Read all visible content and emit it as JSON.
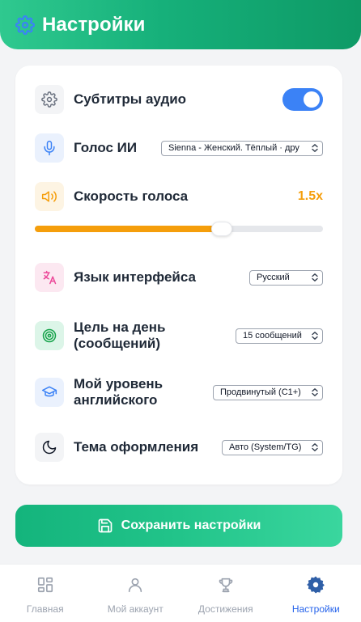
{
  "header": {
    "title": "Настройки",
    "icon": "gear-icon"
  },
  "settings": {
    "subtitles": {
      "label": "Субтитры аудио",
      "enabled": true,
      "icon": "gear-icon"
    },
    "voice": {
      "label": "Голос ИИ",
      "value": "Sienna - Женский. Тёплый · дру",
      "icon": "microphone-icon"
    },
    "speed": {
      "label": "Скорость голоса",
      "value": "1.5x",
      "level_percent": 65,
      "icon": "speaker-icon"
    },
    "language": {
      "label": "Язык интерфейса",
      "value": "Русский",
      "icon": "translate-icon"
    },
    "goal": {
      "label": "Цель на день (сообщений)",
      "value": "15 сообщений",
      "icon": "target-icon"
    },
    "level": {
      "label": "Мой уровень английского",
      "value": "Продвинутый (C1+)",
      "icon": "graduation-cap-icon"
    },
    "theme": {
      "label": "Тема оформления",
      "value": "Авто (System/TG)",
      "icon": "moon-icon"
    }
  },
  "save_button": {
    "label": "Сохранить настройки",
    "icon": "floppy-disk-icon"
  },
  "nav": [
    {
      "label": "Главная",
      "icon": "grid-icon",
      "active": false
    },
    {
      "label": "Мой аккаунт",
      "icon": "user-icon",
      "active": false
    },
    {
      "label": "Достижения",
      "icon": "trophy-icon",
      "active": false
    },
    {
      "label": "Настройки",
      "icon": "gear-icon",
      "active": true
    }
  ],
  "colors": {
    "accent_green": "#1fb883",
    "toggle_blue": "#3b82f6",
    "speed_orange": "#f59e0b",
    "nav_active": "#2563eb"
  }
}
